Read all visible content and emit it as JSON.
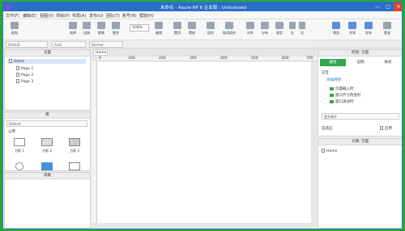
{
  "window": {
    "title": "未命名 - Axure RP 8 企业版 : Unlicensed",
    "minimize": "—",
    "maximize": "□",
    "close": "✕"
  },
  "menu": [
    "文件(F)",
    "编辑(E)",
    "视图(V)",
    "项目(P)",
    "布局(A)",
    "发布(U)",
    "团队(T)",
    "账号(N)",
    "帮助(H)"
  ],
  "toolbar": {
    "paste": "粘贴",
    "select": "选择",
    "connect": "连接",
    "pen": "钢笔",
    "more": "更多",
    "zoom_value": "100%",
    "zoom_label": "缩放",
    "group": "组合",
    "ungroup": "取消组合",
    "top": "置顶",
    "bottom": "置底",
    "align": "对齐",
    "distribute": "分布",
    "lock": "锁定",
    "left": "左",
    "right": "右",
    "preview": "预览",
    "share": "共享",
    "publish": "发布",
    "login": "登录"
  },
  "formatbar": {
    "style": "Default",
    "font": "Arial",
    "weight": "Normal"
  },
  "pages": {
    "title": "页面",
    "home": "Home",
    "items": [
      "Page 1",
      "Page 2",
      "Page 3"
    ]
  },
  "library": {
    "title": "库",
    "selected": "Default",
    "group": "公用",
    "widgets": [
      "方框 1",
      "方框 2",
      "方框 3"
    ]
  },
  "masters": {
    "title": "母版"
  },
  "canvas": {
    "tab": "Home",
    "ruler_ticks": [
      "0",
      "100",
      "200",
      "300",
      "400",
      "500",
      "600",
      "700"
    ]
  },
  "inspector": {
    "title": "检视: 页面",
    "tabs": [
      "属性",
      "说明",
      "样式"
    ],
    "interaction_title": "交互",
    "add_case": "添加用例",
    "events": [
      "页面载入时",
      "窗口尺寸改变时",
      "窗口滚动时"
    ],
    "more_events": "更多事件",
    "adaptive_label": "自适应",
    "enable_label": "启用"
  },
  "outline": {
    "title": "大纲: 页面",
    "root": "Home"
  },
  "colors": {
    "accent": "#2a6ec8",
    "green": "#3aa63a",
    "frame": "#2aa630"
  }
}
